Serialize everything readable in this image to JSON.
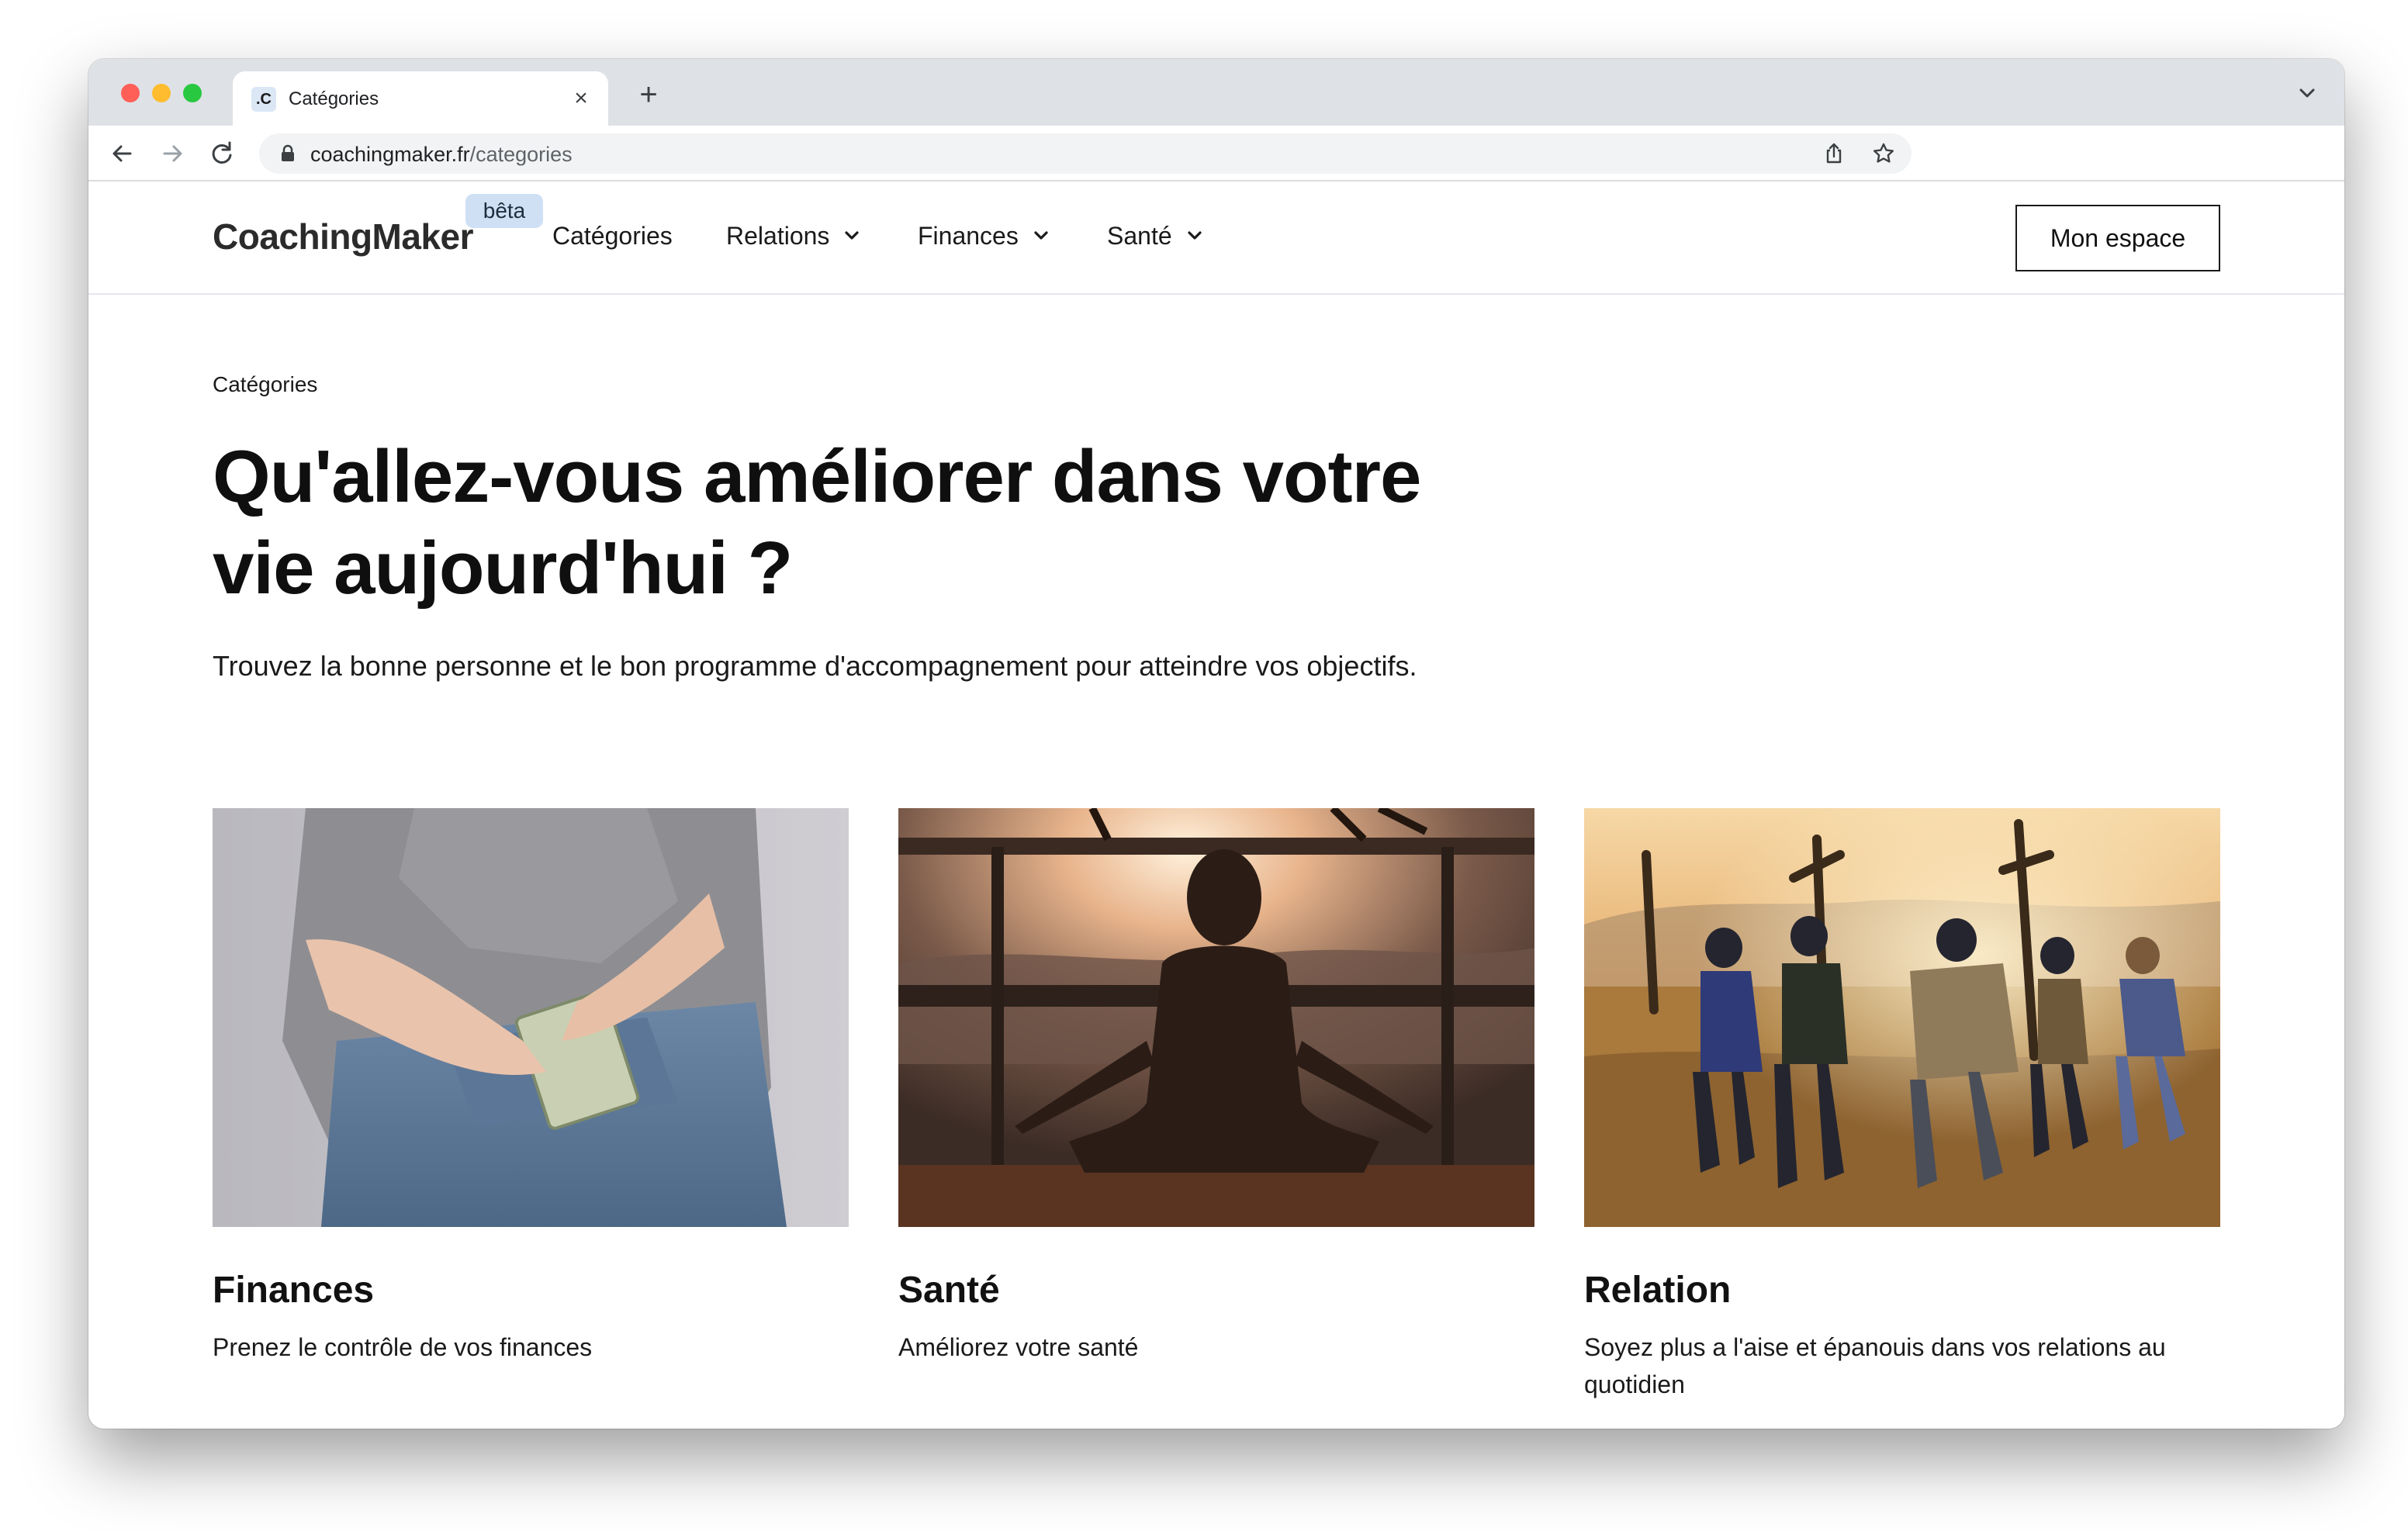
{
  "browser": {
    "tab_title": "Catégories",
    "tab_favicon": ".C",
    "url_host": "coachingmaker.fr",
    "url_path": "/categories"
  },
  "header": {
    "logo": "CoachingMaker",
    "beta_badge": "bêta",
    "nav": [
      {
        "label": "Catégories",
        "has_dropdown": false
      },
      {
        "label": "Relations",
        "has_dropdown": true
      },
      {
        "label": "Finances",
        "has_dropdown": true
      },
      {
        "label": "Santé",
        "has_dropdown": true
      }
    ],
    "cta": "Mon espace"
  },
  "page": {
    "breadcrumb": "Catégories",
    "title_line1": "Qu'allez-vous améliorer dans votre",
    "title_line2": "vie aujourd'hui ?",
    "subtitle": "Trouvez la bonne personne et le bon programme d'accompagnement pour atteindre vos objectifs."
  },
  "cards": [
    {
      "title": "Finances",
      "description": "Prenez le contrôle de vos finances",
      "image": "finances-photo"
    },
    {
      "title": "Santé",
      "description": "Améliorez votre santé",
      "image": "sante-photo"
    },
    {
      "title": "Relation",
      "description": "Soyez plus a l'aise et épanouis dans vos relations au quotidien",
      "image": "relation-photo"
    }
  ],
  "colors": {
    "beta_bg": "#cfe0f5",
    "text": "#0f0f0f",
    "tabstrip": "#dee1e6"
  }
}
